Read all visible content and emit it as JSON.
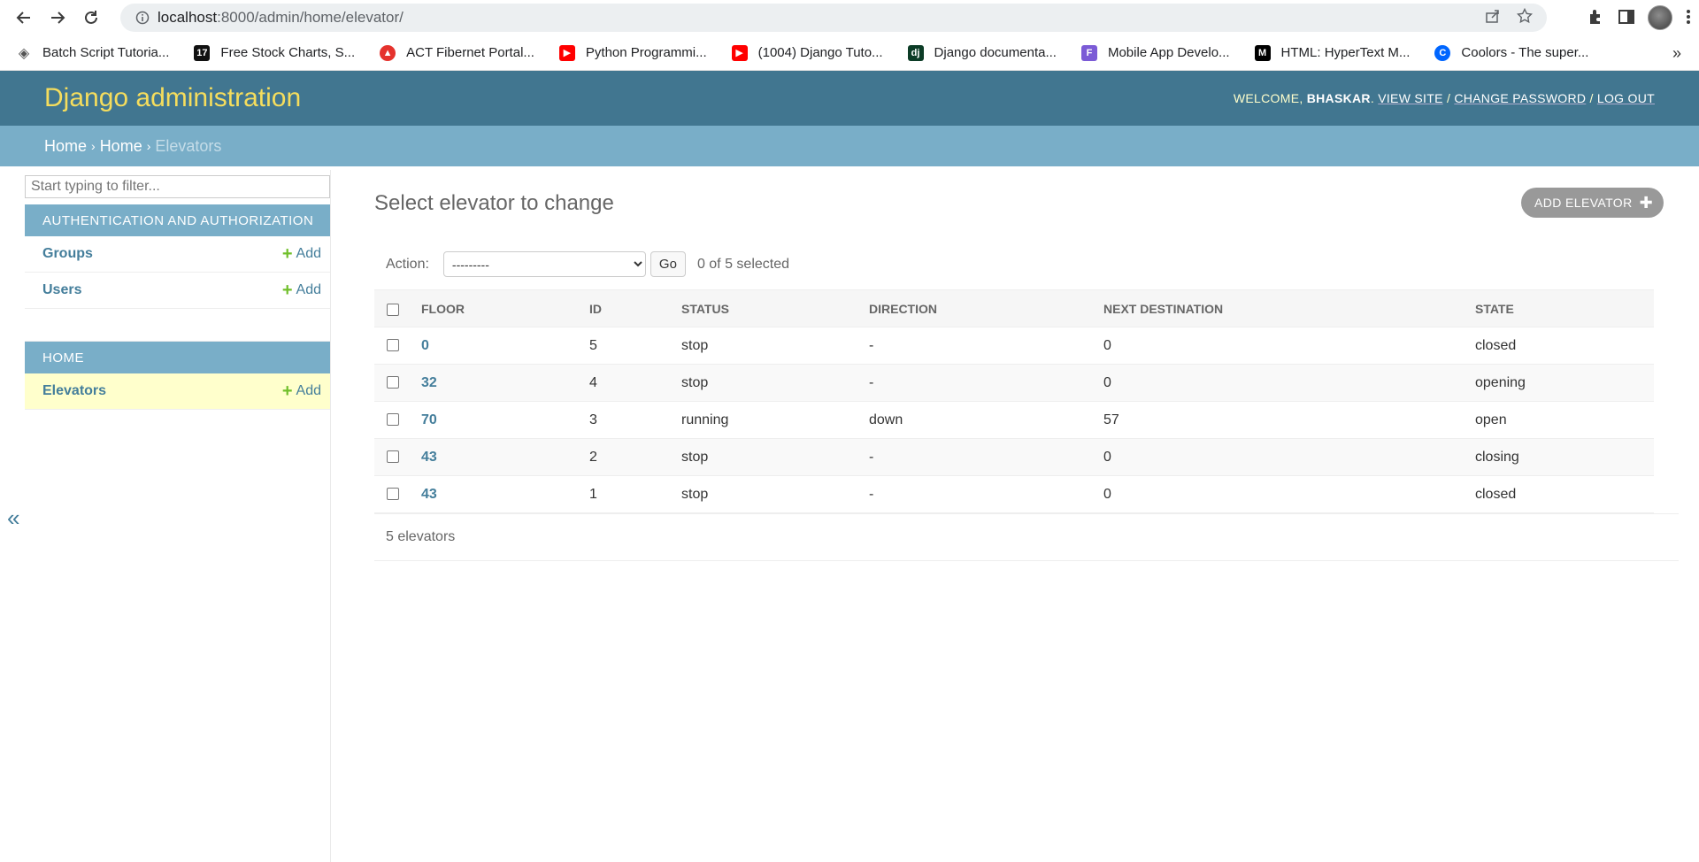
{
  "browser": {
    "url_host": "localhost",
    "url_rest": ":8000/admin/home/elevator/",
    "bookmarks": [
      {
        "label": "Batch Script Tutoria...",
        "icon": "batch-icon",
        "color": "#555555"
      },
      {
        "label": "Free Stock Charts, S...",
        "icon": "tradingview-icon",
        "color": "#111111"
      },
      {
        "label": "ACT Fibernet Portal...",
        "icon": "act-icon",
        "color": "#e5322d"
      },
      {
        "label": "Python Programmi...",
        "icon": "youtube-icon",
        "color": "#ff0000"
      },
      {
        "label": "(1004) Django Tuto...",
        "icon": "youtube-icon",
        "color": "#ff0000"
      },
      {
        "label": "Django documenta...",
        "icon": "django-icon",
        "color": "#0c3c26"
      },
      {
        "label": "Mobile App Develo...",
        "icon": "flutter-icon",
        "color": "#7b5bd6"
      },
      {
        "label": "HTML: HyperText M...",
        "icon": "mdn-icon",
        "color": "#000000"
      },
      {
        "label": "Coolors - The super...",
        "icon": "coolors-icon",
        "color": "#0066ff"
      }
    ],
    "more": "»"
  },
  "header": {
    "branding": "Django administration",
    "welcome": "Welcome, ",
    "username": "bhaskar",
    "dot": ".",
    "view_site": "View site",
    "change_password": "Change password",
    "log_out": "Log out",
    "slash": "/"
  },
  "breadcrumbs": {
    "home": "Home",
    "app": "Home",
    "current": "Elevators",
    "sep": "›"
  },
  "sidebar": {
    "filter_placeholder": "Start typing to filter...",
    "modules": [
      {
        "caption": "Authentication and Authorization",
        "rows": [
          {
            "name": "Groups",
            "add": "Add"
          },
          {
            "name": "Users",
            "add": "Add"
          }
        ]
      },
      {
        "caption": "Home",
        "rows": [
          {
            "name": "Elevators",
            "add": "Add"
          }
        ]
      }
    ],
    "collapse": "«"
  },
  "main": {
    "title": "Select elevator to change",
    "add_button": "Add elevator",
    "action_label": "Action:",
    "action_value": "---------",
    "go": "Go",
    "counter": "0 of 5 selected",
    "columns": [
      "Floor",
      "ID",
      "Status",
      "Direction",
      "Next destination",
      "State"
    ],
    "rows": [
      {
        "floor": "0",
        "id": "5",
        "status": "stop",
        "direction": "-",
        "next": "0",
        "state": "closed"
      },
      {
        "floor": "32",
        "id": "4",
        "status": "stop",
        "direction": "-",
        "next": "0",
        "state": "opening"
      },
      {
        "floor": "70",
        "id": "3",
        "status": "running",
        "direction": "down",
        "next": "57",
        "state": "open"
      },
      {
        "floor": "43",
        "id": "2",
        "status": "stop",
        "direction": "-",
        "next": "0",
        "state": "closing"
      },
      {
        "floor": "43",
        "id": "1",
        "status": "stop",
        "direction": "-",
        "next": "0",
        "state": "closed"
      }
    ],
    "paginator": "5 elevators"
  }
}
